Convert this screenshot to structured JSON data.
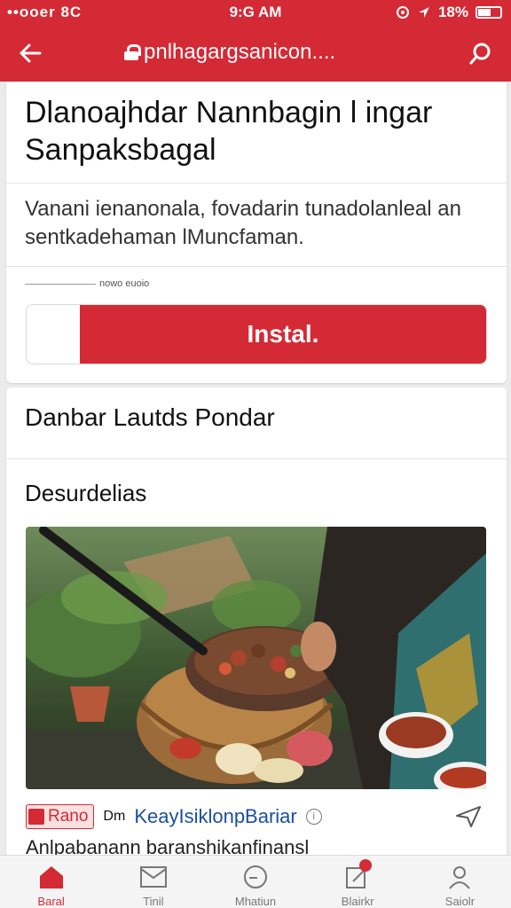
{
  "status_bar": {
    "carrier": "••ooer 8C",
    "time": "9:G AM",
    "battery": "18%"
  },
  "app_bar": {
    "url": "pnlhagargsanicon...."
  },
  "app_card": {
    "title": "Dlanoajhdar Nannbagin l ingar Sanpaksbagal",
    "description": "Vanani ienanonala, fovadarin tunadolanleal an sentkadehaman lMuncfaman.",
    "meta": "nowo euoio",
    "install_label": "Instal."
  },
  "content_card": {
    "section_title": "Danbar Lautds Pondar",
    "sub_title": "Desurdelias",
    "source": {
      "name": "Rano",
      "by": "Dm",
      "author": "KeayIsiklonpBariar",
      "info": "i"
    },
    "caption": "Anlpabanann baranshikanfinansl"
  },
  "bottom_nav": {
    "items": [
      {
        "label": "Baral",
        "icon": "home-icon",
        "active": true
      },
      {
        "label": "Tinil",
        "icon": "mail-icon",
        "active": false
      },
      {
        "label": "Mhatiun",
        "icon": "clock-icon",
        "active": false
      },
      {
        "label": "Blairkr",
        "icon": "edit-icon",
        "active": false
      },
      {
        "label": "Saiolr",
        "icon": "profile-icon",
        "active": false
      }
    ]
  },
  "colors": {
    "brand_red": "#d42a35",
    "link_blue": "#1a4fa0"
  }
}
